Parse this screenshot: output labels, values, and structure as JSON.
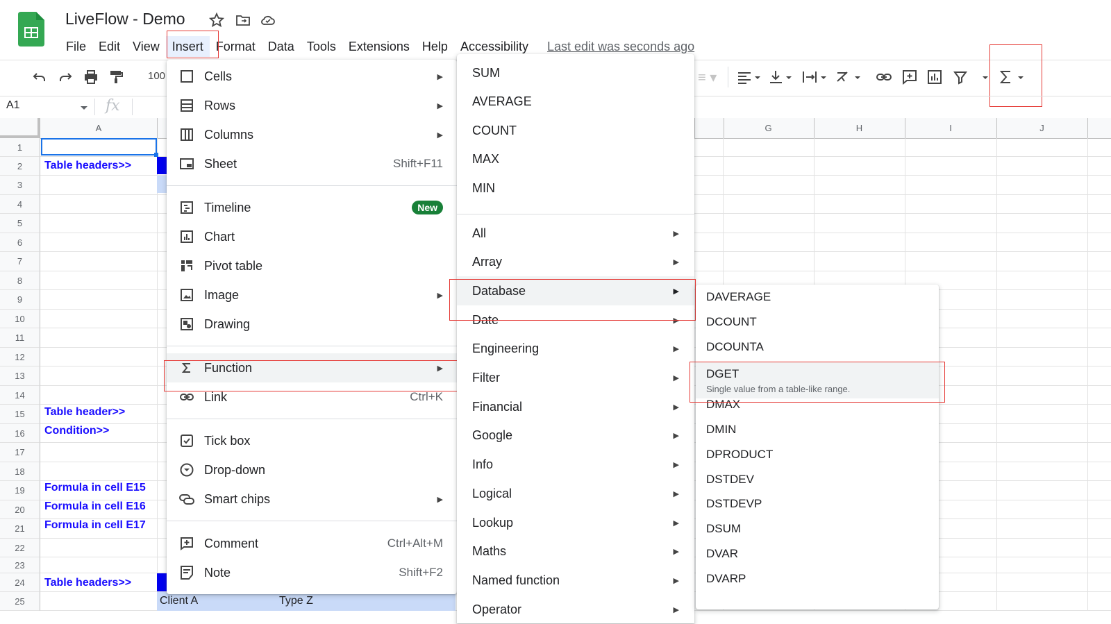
{
  "app": {
    "title": "LiveFlow - Demo",
    "last_edit": "Last edit was seconds ago"
  },
  "menubar": [
    "File",
    "Edit",
    "View",
    "Insert",
    "Format",
    "Data",
    "Tools",
    "Extensions",
    "Help",
    "Accessibility"
  ],
  "toolbar": {
    "zoom": "100",
    "namebox": "A1",
    "fx": "fx"
  },
  "columns": [
    "A",
    "G",
    "H",
    "I",
    "J"
  ],
  "rows": [
    "1",
    "2",
    "3",
    "4",
    "5",
    "6",
    "7",
    "8",
    "9",
    "10",
    "11",
    "12",
    "13",
    "14",
    "15",
    "16",
    "17",
    "18",
    "19",
    "20",
    "21",
    "22",
    "23",
    "24",
    "25"
  ],
  "cells": {
    "r2": "Table headers>>",
    "r15": "Table header>>",
    "r16": "Condition>>",
    "r19": "Formula in cell E15",
    "r20": "Formula in cell E16",
    "r21": "Formula in cell E17",
    "r24": "Table headers>>",
    "r25b": "Client A",
    "r25c": "Type Z"
  },
  "insert_menu": {
    "items": [
      {
        "label": "Cells",
        "shortcut": "",
        "arrow": true
      },
      {
        "label": "Rows",
        "shortcut": "",
        "arrow": true
      },
      {
        "label": "Columns",
        "shortcut": "",
        "arrow": true
      },
      {
        "label": "Sheet",
        "shortcut": "Shift+F11",
        "arrow": false
      },
      {
        "label": "Timeline",
        "badge": "New"
      },
      {
        "label": "Chart"
      },
      {
        "label": "Pivot table"
      },
      {
        "label": "Image",
        "arrow": true
      },
      {
        "label": "Drawing"
      },
      {
        "label": "Function",
        "arrow": true
      },
      {
        "label": "Link",
        "shortcut": "Ctrl+K"
      },
      {
        "label": "Tick box"
      },
      {
        "label": "Drop-down"
      },
      {
        "label": "Smart chips",
        "arrow": true
      },
      {
        "label": "Comment",
        "shortcut": "Ctrl+Alt+M"
      },
      {
        "label": "Note",
        "shortcut": "Shift+F2"
      }
    ]
  },
  "function_menu": {
    "quick": [
      "SUM",
      "AVERAGE",
      "COUNT",
      "MAX",
      "MIN"
    ],
    "categories": [
      "All",
      "Array",
      "Database",
      "Date",
      "Engineering",
      "Filter",
      "Financial",
      "Google",
      "Info",
      "Logical",
      "Lookup",
      "Maths",
      "Named function",
      "Operator"
    ]
  },
  "database_menu": {
    "items": [
      "DAVERAGE",
      "DCOUNT",
      "DCOUNTA",
      "DGET",
      "DMAX",
      "DMIN",
      "DPRODUCT",
      "DSTDEV",
      "DSTDEVP",
      "DSUM",
      "DVAR",
      "DVARP"
    ],
    "dget_desc": "Single value from a table-like range."
  },
  "colors": {
    "accent_red": "#e53935",
    "link_blue": "#1a0dff",
    "badge_green": "#188038",
    "header_blue": "#0000ee"
  }
}
